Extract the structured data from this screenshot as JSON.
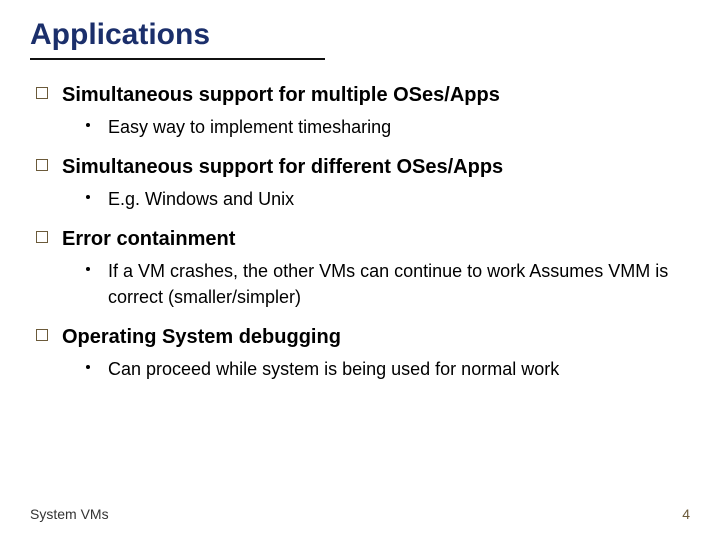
{
  "title": "Applications",
  "items": [
    {
      "heading": "Simultaneous support for multiple OSes/Apps",
      "sub": "Easy way to implement timesharing"
    },
    {
      "heading": "Simultaneous support for different OSes/Apps",
      "sub": "E.g. Windows and Unix"
    },
    {
      "heading": "Error containment",
      "sub": "If a VM crashes, the other VMs can continue to work Assumes VMM is correct (smaller/simpler)"
    },
    {
      "heading": "Operating System debugging",
      "sub": "Can proceed while system is being used for normal work"
    }
  ],
  "footer": {
    "left": "System VMs",
    "page": "4"
  }
}
